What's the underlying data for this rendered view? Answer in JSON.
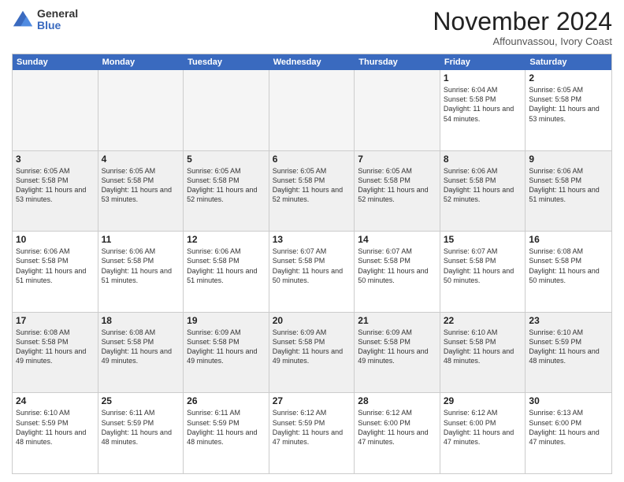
{
  "logo": {
    "general": "General",
    "blue": "Blue"
  },
  "title": "November 2024",
  "location": "Affounvassou, Ivory Coast",
  "days_of_week": [
    "Sunday",
    "Monday",
    "Tuesday",
    "Wednesday",
    "Thursday",
    "Friday",
    "Saturday"
  ],
  "weeks": [
    {
      "cells": [
        {
          "day": null,
          "empty": true
        },
        {
          "day": null,
          "empty": true
        },
        {
          "day": null,
          "empty": true
        },
        {
          "day": null,
          "empty": true
        },
        {
          "day": null,
          "empty": true
        },
        {
          "day": "1",
          "sunrise": "Sunrise: 6:04 AM",
          "sunset": "Sunset: 5:58 PM",
          "daylight": "Daylight: 11 hours and 54 minutes."
        },
        {
          "day": "2",
          "sunrise": "Sunrise: 6:05 AM",
          "sunset": "Sunset: 5:58 PM",
          "daylight": "Daylight: 11 hours and 53 minutes."
        }
      ]
    },
    {
      "cells": [
        {
          "day": "3",
          "sunrise": "Sunrise: 6:05 AM",
          "sunset": "Sunset: 5:58 PM",
          "daylight": "Daylight: 11 hours and 53 minutes."
        },
        {
          "day": "4",
          "sunrise": "Sunrise: 6:05 AM",
          "sunset": "Sunset: 5:58 PM",
          "daylight": "Daylight: 11 hours and 53 minutes."
        },
        {
          "day": "5",
          "sunrise": "Sunrise: 6:05 AM",
          "sunset": "Sunset: 5:58 PM",
          "daylight": "Daylight: 11 hours and 52 minutes."
        },
        {
          "day": "6",
          "sunrise": "Sunrise: 6:05 AM",
          "sunset": "Sunset: 5:58 PM",
          "daylight": "Daylight: 11 hours and 52 minutes."
        },
        {
          "day": "7",
          "sunrise": "Sunrise: 6:05 AM",
          "sunset": "Sunset: 5:58 PM",
          "daylight": "Daylight: 11 hours and 52 minutes."
        },
        {
          "day": "8",
          "sunrise": "Sunrise: 6:06 AM",
          "sunset": "Sunset: 5:58 PM",
          "daylight": "Daylight: 11 hours and 52 minutes."
        },
        {
          "day": "9",
          "sunrise": "Sunrise: 6:06 AM",
          "sunset": "Sunset: 5:58 PM",
          "daylight": "Daylight: 11 hours and 51 minutes."
        }
      ]
    },
    {
      "cells": [
        {
          "day": "10",
          "sunrise": "Sunrise: 6:06 AM",
          "sunset": "Sunset: 5:58 PM",
          "daylight": "Daylight: 11 hours and 51 minutes."
        },
        {
          "day": "11",
          "sunrise": "Sunrise: 6:06 AM",
          "sunset": "Sunset: 5:58 PM",
          "daylight": "Daylight: 11 hours and 51 minutes."
        },
        {
          "day": "12",
          "sunrise": "Sunrise: 6:06 AM",
          "sunset": "Sunset: 5:58 PM",
          "daylight": "Daylight: 11 hours and 51 minutes."
        },
        {
          "day": "13",
          "sunrise": "Sunrise: 6:07 AM",
          "sunset": "Sunset: 5:58 PM",
          "daylight": "Daylight: 11 hours and 50 minutes."
        },
        {
          "day": "14",
          "sunrise": "Sunrise: 6:07 AM",
          "sunset": "Sunset: 5:58 PM",
          "daylight": "Daylight: 11 hours and 50 minutes."
        },
        {
          "day": "15",
          "sunrise": "Sunrise: 6:07 AM",
          "sunset": "Sunset: 5:58 PM",
          "daylight": "Daylight: 11 hours and 50 minutes."
        },
        {
          "day": "16",
          "sunrise": "Sunrise: 6:08 AM",
          "sunset": "Sunset: 5:58 PM",
          "daylight": "Daylight: 11 hours and 50 minutes."
        }
      ]
    },
    {
      "cells": [
        {
          "day": "17",
          "sunrise": "Sunrise: 6:08 AM",
          "sunset": "Sunset: 5:58 PM",
          "daylight": "Daylight: 11 hours and 49 minutes."
        },
        {
          "day": "18",
          "sunrise": "Sunrise: 6:08 AM",
          "sunset": "Sunset: 5:58 PM",
          "daylight": "Daylight: 11 hours and 49 minutes."
        },
        {
          "day": "19",
          "sunrise": "Sunrise: 6:09 AM",
          "sunset": "Sunset: 5:58 PM",
          "daylight": "Daylight: 11 hours and 49 minutes."
        },
        {
          "day": "20",
          "sunrise": "Sunrise: 6:09 AM",
          "sunset": "Sunset: 5:58 PM",
          "daylight": "Daylight: 11 hours and 49 minutes."
        },
        {
          "day": "21",
          "sunrise": "Sunrise: 6:09 AM",
          "sunset": "Sunset: 5:58 PM",
          "daylight": "Daylight: 11 hours and 49 minutes."
        },
        {
          "day": "22",
          "sunrise": "Sunrise: 6:10 AM",
          "sunset": "Sunset: 5:58 PM",
          "daylight": "Daylight: 11 hours and 48 minutes."
        },
        {
          "day": "23",
          "sunrise": "Sunrise: 6:10 AM",
          "sunset": "Sunset: 5:59 PM",
          "daylight": "Daylight: 11 hours and 48 minutes."
        }
      ]
    },
    {
      "cells": [
        {
          "day": "24",
          "sunrise": "Sunrise: 6:10 AM",
          "sunset": "Sunset: 5:59 PM",
          "daylight": "Daylight: 11 hours and 48 minutes."
        },
        {
          "day": "25",
          "sunrise": "Sunrise: 6:11 AM",
          "sunset": "Sunset: 5:59 PM",
          "daylight": "Daylight: 11 hours and 48 minutes."
        },
        {
          "day": "26",
          "sunrise": "Sunrise: 6:11 AM",
          "sunset": "Sunset: 5:59 PM",
          "daylight": "Daylight: 11 hours and 48 minutes."
        },
        {
          "day": "27",
          "sunrise": "Sunrise: 6:12 AM",
          "sunset": "Sunset: 5:59 PM",
          "daylight": "Daylight: 11 hours and 47 minutes."
        },
        {
          "day": "28",
          "sunrise": "Sunrise: 6:12 AM",
          "sunset": "Sunset: 6:00 PM",
          "daylight": "Daylight: 11 hours and 47 minutes."
        },
        {
          "day": "29",
          "sunrise": "Sunrise: 6:12 AM",
          "sunset": "Sunset: 6:00 PM",
          "daylight": "Daylight: 11 hours and 47 minutes."
        },
        {
          "day": "30",
          "sunrise": "Sunrise: 6:13 AM",
          "sunset": "Sunset: 6:00 PM",
          "daylight": "Daylight: 11 hours and 47 minutes."
        }
      ]
    }
  ]
}
